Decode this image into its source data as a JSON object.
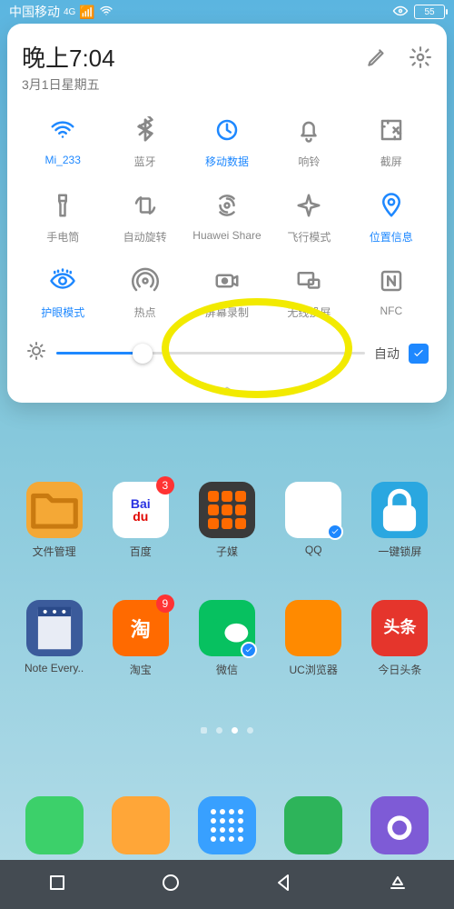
{
  "status": {
    "carrier": "中国移动",
    "network": "4G",
    "battery": "55"
  },
  "panel": {
    "time": "晚上7:04",
    "date": "3月1日星期五",
    "tiles": [
      {
        "label": "Mi_233",
        "active": true,
        "icon": "wifi"
      },
      {
        "label": "蓝牙",
        "active": false,
        "icon": "bluetooth"
      },
      {
        "label": "移动数据",
        "active": true,
        "icon": "mobile-data"
      },
      {
        "label": "响铃",
        "active": false,
        "icon": "bell"
      },
      {
        "label": "截屏",
        "active": false,
        "icon": "screenshot"
      },
      {
        "label": "手电筒",
        "active": false,
        "icon": "flashlight"
      },
      {
        "label": "自动旋转",
        "active": false,
        "icon": "auto-rotate"
      },
      {
        "label": "Huawei Share",
        "active": false,
        "icon": "huawei-share"
      },
      {
        "label": "飞行模式",
        "active": false,
        "icon": "airplane"
      },
      {
        "label": "位置信息",
        "active": true,
        "icon": "location"
      },
      {
        "label": "护眼模式",
        "active": true,
        "icon": "eye-comfort"
      },
      {
        "label": "热点",
        "active": false,
        "icon": "hotspot"
      },
      {
        "label": "屏幕录制",
        "active": false,
        "icon": "screen-record"
      },
      {
        "label": "无线投屏",
        "active": false,
        "icon": "cast"
      },
      {
        "label": "NFC",
        "active": false,
        "icon": "nfc"
      }
    ],
    "brightness": {
      "auto_label": "自动",
      "checked": true,
      "value": 28
    }
  },
  "apps_row1": [
    {
      "label": "文件管理",
      "color": "#f4a836",
      "icon": "folder"
    },
    {
      "label": "百度",
      "color": "#ffffff",
      "icon": "baidu",
      "badge": "3"
    },
    {
      "label": "子媒",
      "color": "#3a3a3a",
      "icon": "grid"
    },
    {
      "label": "QQ",
      "color": "#ffffff",
      "icon": "qq",
      "shield": true
    },
    {
      "label": "一键锁屏",
      "color": "#2aa7e0",
      "icon": "lock"
    }
  ],
  "apps_row2": [
    {
      "label": "Note Every..",
      "color": "#3b5b9b",
      "icon": "note"
    },
    {
      "label": "淘宝",
      "color": "#ff6a00",
      "icon": "taobao",
      "badge": "9"
    },
    {
      "label": "微信",
      "color": "#07c160",
      "icon": "wechat",
      "shield": true
    },
    {
      "label": "UC浏览器",
      "color": "#ff8a00",
      "icon": "uc"
    },
    {
      "label": "今日头条",
      "color": "#e5352c",
      "icon": "toutiao"
    }
  ],
  "dock": [
    {
      "color": "#3cd06a",
      "icon": "messages"
    },
    {
      "color": "#ffa638",
      "icon": "contacts"
    },
    {
      "color": "#38a0ff",
      "icon": "apps"
    },
    {
      "color": "#2db45a",
      "icon": "phone"
    },
    {
      "color": "#7e5bd6",
      "icon": "camera"
    }
  ]
}
